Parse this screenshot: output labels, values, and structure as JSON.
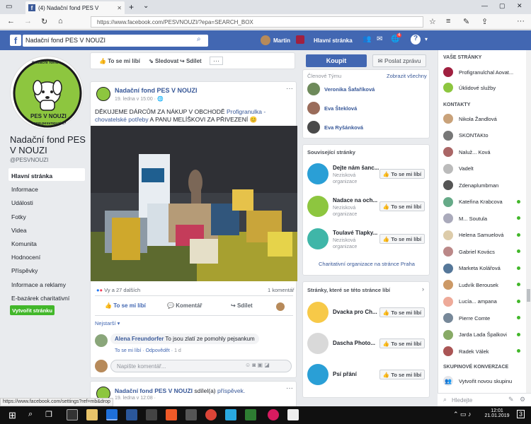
{
  "browser": {
    "tab_title": "(4) Nadační fond PES V",
    "url": "https://www.facebook.com/PESVNOUZI/?epa=SEARCH_BOX",
    "status_url": "https://www.facebook.com/settings?ref=mb&drop"
  },
  "fb_header": {
    "search_value": "Nadační fond PES V NOUZI",
    "user_name": "Martin",
    "home_label": "Hlavní stránka",
    "notif_count": "4"
  },
  "page": {
    "name": "Nadační fond PES V NOUZI",
    "handle": "@PESVNOUZI",
    "logo_text_top": "nadační fond",
    "logo_text_bottom": "PES V NOUZI",
    "logo_url": "www.pesvnouzi.cz",
    "nav": [
      "Hlavní stránka",
      "Informace",
      "Události",
      "Fotky",
      "Videa",
      "Komunita",
      "Hodnocení",
      "Příspěvky",
      "Informace a reklamy",
      "E-bazárek charitativní"
    ],
    "create_button": "Vytvořit stránku"
  },
  "actions": {
    "like": "To se mi líbí",
    "follow": "Sledovat",
    "share": "Sdílet",
    "more": "···",
    "buy": "Koupit",
    "message": "Poslat zprávu"
  },
  "post1": {
    "author": "Nadační fond PES V NOUZI",
    "date": "19. ledna v 15:00 ·",
    "text_a": "DĚKUJEME DÁRCŮM ZA NÁKUP V OBCHODĚ ",
    "text_link": "Profigranulka - chovatelské potřeby",
    "text_b": " A PANU MELÍŠKOVI ZA PŘIVEZENÍ 😊",
    "reactions": "Vy a 27 dalších",
    "comments_count": "1 komentář",
    "btn_like": "To se mi líbí",
    "btn_comment": "Komentář",
    "btn_share": "Sdílet",
    "sort": "Nejstarší ▾",
    "comment_author": "Alena Freundorfer",
    "comment_text": " To jsou zlatí ze pomohly pejsankum",
    "comment_like": "To se mi líbí",
    "comment_reply": "Odpovědět",
    "comment_time": "1 d",
    "comment_placeholder": "Napište komentář..."
  },
  "post2": {
    "author": "Nadační fond PES V NOUZI",
    "shared": " sdílel(a) ",
    "shared_link": "příspěvek.",
    "date": "19. ledna v 12:08 ·"
  },
  "team": {
    "title": "Členové Týmu",
    "show_all": "Zobrazit všechny",
    "members": [
      "Veronika Šafaříková",
      "Eva Šteklová",
      "Eva Ryšánková"
    ]
  },
  "related": {
    "title": "Související stránky",
    "items": [
      {
        "name": "Dejte nám šanc...",
        "type": "Nezisková organizace"
      },
      {
        "name": "Nadace na och...",
        "type": "Nezisková organizace"
      },
      {
        "name": "Toulavé Tlapky...",
        "type": "Nezisková organizace"
      }
    ],
    "footer": "Charitativní organizace na stránce Praha",
    "like": "To se mi líbí"
  },
  "liked_pages": {
    "title": "Stránky, které se této stránce líbí",
    "items": [
      "Dvacka pro Ch...",
      "Dascha Photo...",
      "Psí přání"
    ],
    "like": "To se mi líbí"
  },
  "chat": {
    "your_pages_title": "VAŠE STRÁNKY",
    "your_pages": [
      "Profigranulchal Aovat...",
      "Úklidové služby"
    ],
    "contacts_title": "KONTAKTY",
    "contacts": [
      {
        "name": "Nikola Žandlová",
        "online": false
      },
      {
        "name": "SKONTAKto",
        "online": false
      },
      {
        "name": "Naluž... Ková",
        "online": false
      },
      {
        "name": "Vadelt",
        "online": false
      },
      {
        "name": "Zdenaplumbman",
        "online": false
      },
      {
        "name": "Kateřina Krabcova",
        "online": true
      },
      {
        "name": "M... Soutula",
        "online": true
      },
      {
        "name": "Helena Samuelová",
        "online": true
      },
      {
        "name": "Gabriel Kovács",
        "online": true
      },
      {
        "name": "Marketa Kolářová",
        "online": true
      },
      {
        "name": "Ludvík Berousek",
        "online": true
      },
      {
        "name": "Lucía... ampana",
        "online": true
      },
      {
        "name": "Pierre Comte",
        "online": true
      },
      {
        "name": "Jarda Lada Špalkovi",
        "online": true
      },
      {
        "name": "Radek Válek",
        "online": true
      }
    ],
    "group_title": "SKUPINOVÉ KONVERZACE",
    "new_group": "Vytvořit novou skupinu",
    "search_placeholder": "Hledejte"
  },
  "taskbar": {
    "time": "12:01",
    "date": "21.01.2019",
    "notif": "3"
  },
  "colors": {
    "fb_blue": "#4267b2",
    "link_blue": "#385898",
    "green": "#42b72a",
    "logo_green": "#8dc63f"
  }
}
